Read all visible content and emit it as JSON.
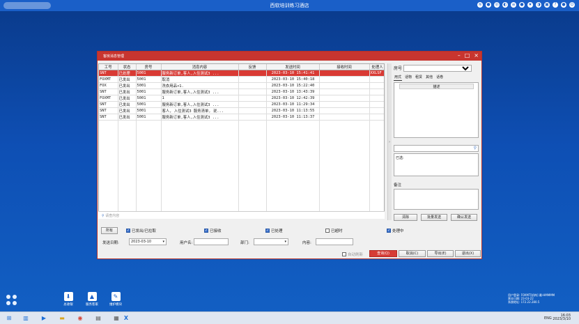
{
  "topbar": {
    "title": "西软培训练习酒店"
  },
  "window": {
    "title": "客房消息管理",
    "columns": [
      "工号",
      "状态",
      "房号",
      "消息内容",
      "反馈",
      "发送时间",
      "接收时间",
      "处理人"
    ],
    "rows": [
      [
        "SNT",
        "已处理",
        "5001",
        "服务新订单,客人,入住测试3 ...",
        "",
        "2023-03-10 15:41:41",
        "",
        "XXLSF"
      ],
      [
        "FOXMT",
        "已发出",
        "5001",
        "取消",
        "",
        "2023-03-10 15:40:18",
        "",
        ""
      ],
      [
        "FOX",
        "已发出",
        "5001",
        "洗衣用品×1.",
        "",
        "2023-03-10 15:22:40",
        "",
        ""
      ],
      [
        "SNT",
        "已发出",
        "5001",
        "服务新订单,客人,入住测试3 ...",
        "",
        "2023-03-10 13:43:39",
        "",
        ""
      ],
      [
        "FOXMT",
        "已发出",
        "5001",
        "1",
        "",
        "2023-03-10 12:42:39",
        "",
        ""
      ],
      [
        "SNT",
        "已发出",
        "5001",
        "服务新订单,客人,入住测试3 ...",
        "",
        "2023-03-10 11:29:34",
        "",
        ""
      ],
      [
        "SNT",
        "已发出",
        "5001",
        "客人, 入住测试3 服务清单, 说...",
        "",
        "2023-03-10 11:13:55",
        "",
        ""
      ],
      [
        "SNT",
        "已发出",
        "5001",
        "服务新订单,客人,入住测试3 ...",
        "",
        "2023-03-10 11:13:37",
        "",
        ""
      ]
    ],
    "search_placeholder": "请查内容",
    "right": {
      "room_label": "房号",
      "tabs": [
        "用式",
        "话物",
        "租赁",
        "其他",
        "话卷"
      ],
      "desc_header": "描述",
      "sent_label": "已选:",
      "note_label": "备注",
      "clear_btn": "清除",
      "batch_btn": "批量发送",
      "confirm_btn": "确认发送"
    },
    "filters": {
      "all_btn": "所有",
      "checks": [
        {
          "label": "已发出/已拉取",
          "checked": true
        },
        {
          "label": "已接收",
          "checked": true
        },
        {
          "label": "已处理",
          "checked": true
        },
        {
          "label": "已超时",
          "checked": false
        },
        {
          "label": "处理中",
          "checked": true
        }
      ],
      "date_label": "发送日期:",
      "date_value": "2023-03-10",
      "user_label": "用户名:",
      "dept_label": "部门:",
      "content_label": "内容:",
      "auto_refresh": "自动刷新",
      "query_btn": "查询(Q)",
      "cancel_btn": "取消(C)",
      "export_btn": "导出(E)",
      "exit_btn": "退出(X)"
    }
  },
  "shortcuts": [
    {
      "label": "总收银",
      "icon": "download-icon"
    },
    {
      "label": "服务客家",
      "icon": "hat-icon"
    },
    {
      "label": "维护模块",
      "icon": "wrench-icon"
    }
  ],
  "sysinfo": {
    "line1": "用户登录: FOXMT[机构] 最-HMMMM",
    "line2": "营业日期: 23-03-22",
    "line3": "系统地址: 172.22.280.5"
  },
  "taskbar": {
    "ime": "ENG",
    "time": "16:03",
    "date": "2023/3/10"
  }
}
